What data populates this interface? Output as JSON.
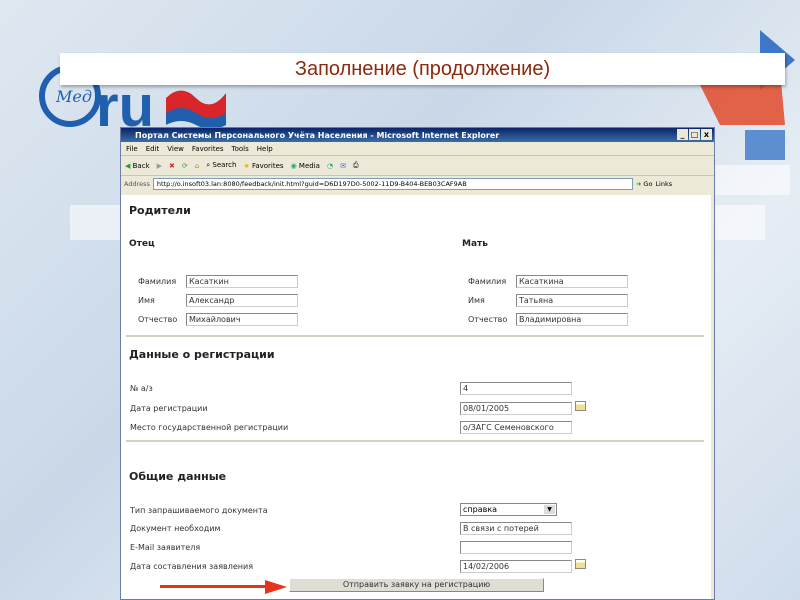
{
  "slide": {
    "title": "Заполнение (продолжение)",
    "logo_text": "Мед.ru"
  },
  "browser": {
    "window_title": "Портал Системы Персонального Учёта Населения - Microsoft Internet Explorer",
    "menu": [
      "File",
      "Edit",
      "View",
      "Favorites",
      "Tools",
      "Help"
    ],
    "toolbar": [
      "Back",
      "Search",
      "Favorites",
      "Media"
    ],
    "address_label": "Address",
    "url": "http://o.insoft03.lan:8080/feedback/init.html?guid=D6D197D0-5002-11D9-B404-BEB03CAF9AB",
    "go": "Go",
    "links": "Links"
  },
  "form": {
    "parents_title": "Родители",
    "father": {
      "title": "Отец",
      "surname_label": "Фамилия",
      "surname": "Касаткин",
      "name_label": "Имя",
      "name": "Александр",
      "patronymic_label": "Отчество",
      "patronymic": "Михайлович"
    },
    "mother": {
      "title": "Мать",
      "surname_label": "Фамилия",
      "surname": "Касаткина",
      "name_label": "Имя",
      "name": "Татьяна",
      "patronymic_label": "Отчество",
      "patronymic": "Владимировна"
    },
    "registration": {
      "title": "Данные о регистрации",
      "num_label": "№ а/з",
      "num": "4",
      "date_label": "Дата регистрации",
      "date": "08/01/2005",
      "place_label": "Место государственной регистрации",
      "place": "о/ЗАГС Семеновского"
    },
    "general": {
      "title": "Общие данные",
      "doc_type_label": "Тип запрашиваемого документа",
      "doc_type": "справка",
      "reason_label": "Документ необходим",
      "reason": "В связи с потерей",
      "email_label": "E-Mail заявителя",
      "email": "",
      "app_date_label": "Дата составления заявления",
      "app_date": "14/02/2006"
    },
    "submit": "Отправить заявку на регистрацию"
  }
}
